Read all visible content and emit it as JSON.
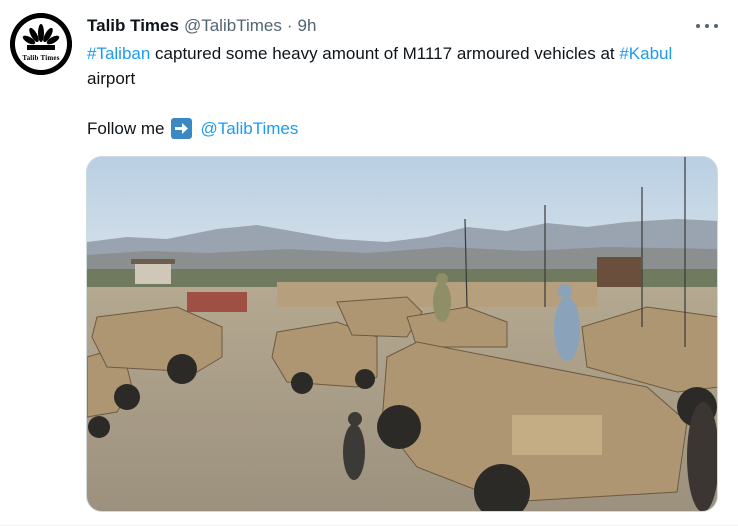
{
  "tweet": {
    "display_name": "Talib Times",
    "handle": "@TalibTimes",
    "separator": "·",
    "time": "9h",
    "text": {
      "hashtag1": "#Taliban",
      "part1": " captured some heavy amount of M1117 armoured vehicles at ",
      "hashtag2": "#Kabul",
      "part2": " airport"
    },
    "follow": {
      "label": "Follow me",
      "mention": "@TalibTimes"
    },
    "avatar_logo_text": "Talib Times",
    "icons": {
      "avatar": "peacock-logo-icon",
      "more": "more-options-icon",
      "arrow": "right-arrow-emoji-icon"
    },
    "media_alt": "Photo of armoured vehicles at an airport"
  },
  "colors": {
    "link": "#1d9bf0",
    "text": "#0f1419",
    "secondary": "#536471",
    "border": "#cfd9de"
  }
}
